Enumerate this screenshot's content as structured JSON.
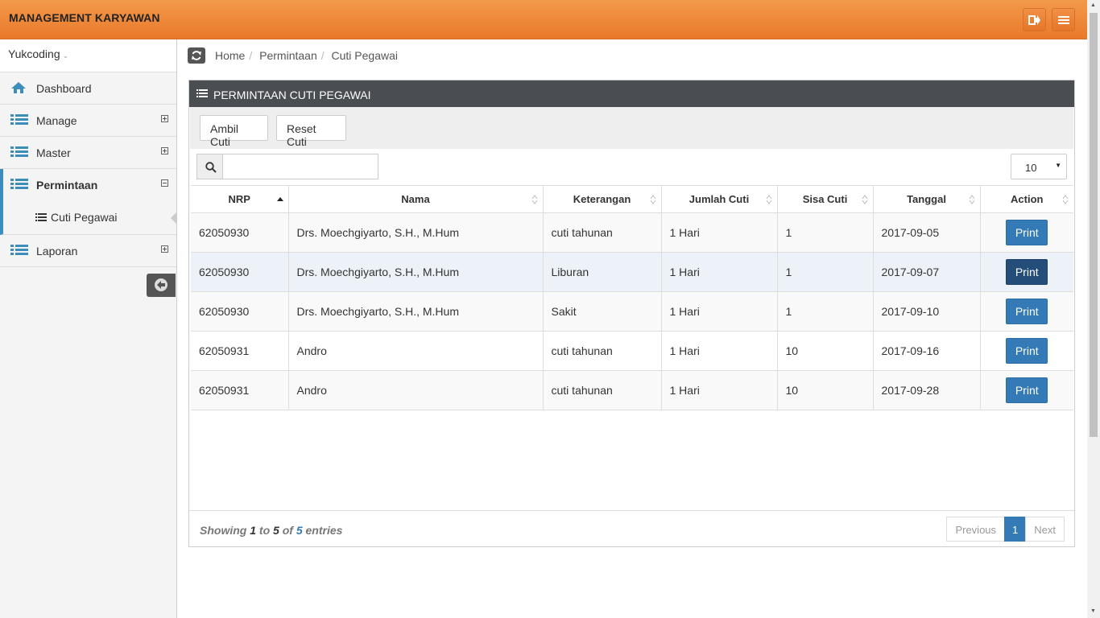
{
  "app": {
    "title": "MANAGEMENT KARYAWAN"
  },
  "topbar": {
    "logout_icon": "sign-out-icon",
    "menu_icon": "bars-icon"
  },
  "sidebar": {
    "user": "Yukcoding",
    "items": [
      {
        "label": "Dashboard",
        "icon": "home-icon"
      },
      {
        "label": "Manage",
        "icon": "list-icon"
      },
      {
        "label": "Master",
        "icon": "list-icon"
      },
      {
        "label": "Permintaan",
        "icon": "list-icon"
      },
      {
        "label": "Laporan",
        "icon": "list-icon"
      }
    ],
    "sub_items": [
      {
        "label": "Cuti Pegawai",
        "icon": "list-icon"
      }
    ]
  },
  "breadcrumb": [
    "Home",
    "Permintaan",
    "Cuti Pegawai"
  ],
  "panel": {
    "title": "PERMINTAAN CUTI PEGAWAI",
    "ambil_label": "Ambil Cuti",
    "reset_label": "Reset Cuti",
    "search_placeholder": "",
    "page_length": "10"
  },
  "table": {
    "columns": [
      "NRP",
      "Nama",
      "Keterangan",
      "Jumlah Cuti",
      "Sisa Cuti",
      "Tanggal",
      "Action"
    ],
    "rows": [
      {
        "nrp": "62050930",
        "nama": "Drs. Moechgiyarto, S.H., M.Hum",
        "ket": "cuti tahunan",
        "jumlah": "1 Hari",
        "sisa": "1",
        "tanggal": "2017-09-05",
        "action": "Print"
      },
      {
        "nrp": "62050930",
        "nama": "Drs. Moechgiyarto, S.H., M.Hum",
        "ket": "Liburan",
        "jumlah": "1 Hari",
        "sisa": "1",
        "tanggal": "2017-09-07",
        "action": "Print"
      },
      {
        "nrp": "62050930",
        "nama": "Drs. Moechgiyarto, S.H., M.Hum",
        "ket": "Sakit",
        "jumlah": "1 Hari",
        "sisa": "1",
        "tanggal": "2017-09-10",
        "action": "Print"
      },
      {
        "nrp": "62050931",
        "nama": "Andro",
        "ket": "cuti tahunan",
        "jumlah": "1 Hari",
        "sisa": "10",
        "tanggal": "2017-09-16",
        "action": "Print"
      },
      {
        "nrp": "62050931",
        "nama": "Andro",
        "ket": "cuti tahunan",
        "jumlah": "1 Hari",
        "sisa": "10",
        "tanggal": "2017-09-28",
        "action": "Print"
      }
    ]
  },
  "footer": {
    "showing": "Showing",
    "start": "1",
    "to": "to",
    "end": "5",
    "of": "of",
    "total": "5",
    "entries": "entries",
    "prev": "Previous",
    "page": "1",
    "next": "Next"
  },
  "colors": {
    "accent": "#337ab7",
    "topbar": "#ef8a3a",
    "panel_head": "#4a4d51"
  }
}
